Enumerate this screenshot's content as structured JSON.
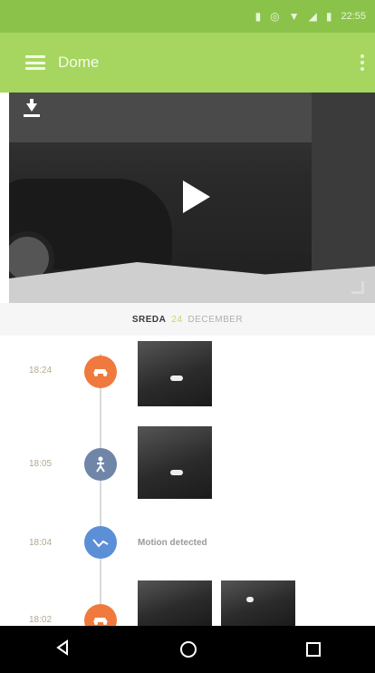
{
  "status_bar": {
    "time": "22:55"
  },
  "toolbar": {
    "title": "Dome"
  },
  "timeline": {
    "date_day": "SREDA",
    "date_num": "24",
    "date_month": "DECEMBER",
    "events": [
      {
        "time": "18:24",
        "type": "car-icon",
        "color": "#f07a3e"
      },
      {
        "time": "18:05",
        "type": "person-icon",
        "color": "#6f86a8"
      },
      {
        "time": "18:04",
        "type": "motion-icon",
        "color": "#5b8fd6",
        "label": "Motion detected"
      },
      {
        "time": "18:02",
        "type": "car-icon",
        "color": "#f07a3e"
      }
    ]
  }
}
